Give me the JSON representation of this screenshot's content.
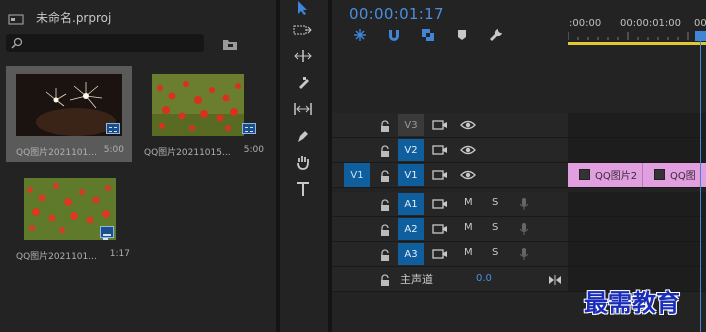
{
  "project": {
    "title": "未命名.prproj",
    "search_placeholder": "",
    "items": [
      {
        "name": "QQ图片2021101...",
        "duration": "5:00",
        "kind": "image",
        "selected": true
      },
      {
        "name": "QQ图片20211015...",
        "duration": "5:00",
        "kind": "image",
        "selected": false
      },
      {
        "name": "QQ图片2021101...",
        "duration": "1:17",
        "kind": "sequence",
        "selected": false
      }
    ]
  },
  "tools": [
    "selection-tool",
    "track-select-tool",
    "ripple-edit-tool",
    "razor-tool",
    "slip-tool",
    "pen-tool",
    "hand-tool",
    "type-tool"
  ],
  "timeline": {
    "timecode": "00:00:01:17",
    "ruler_labels": [
      ":00:00",
      "00:00:01:00",
      "00:"
    ],
    "video_tracks": [
      {
        "target": "V3",
        "source": ""
      },
      {
        "target": "V2",
        "source": ""
      },
      {
        "target": "V1",
        "source": "V1"
      }
    ],
    "audio_tracks": [
      {
        "target": "A1",
        "m": "M",
        "s": "S"
      },
      {
        "target": "A2",
        "m": "M",
        "s": "S"
      },
      {
        "target": "A3",
        "m": "M",
        "s": "S"
      }
    ],
    "master": {
      "label": "主声道",
      "value": "0.0"
    },
    "clips": [
      {
        "label": "QQ图片2"
      },
      {
        "label": "QQ图"
      }
    ]
  },
  "watermark": "最需教育",
  "colors": {
    "accent": "#4a8fe0",
    "clip": "#e19fe0",
    "target_on": "#0f5f9f",
    "ruler_bar": "#e0c832"
  }
}
